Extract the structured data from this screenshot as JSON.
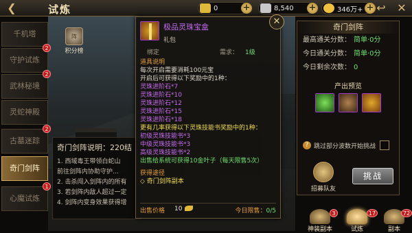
{
  "header": {
    "back_icon": "back-arrow-icon",
    "title": "试炼",
    "resources": [
      {
        "name": "gold-ingot",
        "value": "0",
        "color": "#e0b83a"
      },
      {
        "name": "currency",
        "value": "8,540",
        "color": "#c9c9c9"
      },
      {
        "name": "coin",
        "value": "346万+",
        "color": "#f0c040"
      }
    ]
  },
  "sidebar": {
    "items": [
      {
        "label": "千机塔",
        "badge": null
      },
      {
        "label": "守护试炼",
        "badge": "2"
      },
      {
        "label": "武林秘境",
        "badge": "2"
      },
      {
        "label": "灵蛇神殿",
        "badge": null
      },
      {
        "label": "古墓迷踪",
        "badge": "2"
      },
      {
        "label": "奇门剑阵",
        "badge": null,
        "active": true
      },
      {
        "label": "心魔试炼",
        "badge": "1"
      }
    ]
  },
  "rank": {
    "label": "积分榜",
    "emblem": "阵"
  },
  "description": {
    "title": "奇门剑阵说明：220结",
    "lines": [
      "1. 西域毒王带领白蛇山",
      "前往剑阵内协助守护...",
      "2. 击杀闯入剑阵内的所有",
      "3. 若剑阵内敌人超过一定",
      "4. 剑阵内变身效果获得增"
    ]
  },
  "tooltip": {
    "name": "极品灵珠宝盒",
    "type": "礼包",
    "bound": "绑定",
    "req_label": "需求：",
    "req_value": "1级",
    "lines": [
      {
        "text": "道具说明",
        "color": "orange"
      },
      {
        "text": "每次开启需要消耗100元宝",
        "color": "white"
      },
      {
        "text": "开启后可获得以下奖励中的1种：",
        "color": "white"
      },
      {
        "text": "灵珠进阶石*7",
        "color": "purple"
      },
      {
        "text": "灵珠进阶石*10",
        "color": "purple"
      },
      {
        "text": "灵珠进阶石*12",
        "color": "purple"
      },
      {
        "text": "灵珠进阶石*15",
        "color": "purple"
      },
      {
        "text": "灵珠进阶石*18",
        "color": "purple"
      },
      {
        "text": "更有几率获得以下灵珠技能书奖励中的1种：",
        "color": "yellow"
      },
      {
        "text": "初级灵珠技能书*3",
        "color": "purple"
      },
      {
        "text": "中级灵珠技能书*3",
        "color": "purple"
      },
      {
        "text": "高级灵珠技能书*2",
        "color": "purple"
      },
      {
        "text": "出售给系统可获得10金叶子（每天限售5次）",
        "color": "green"
      },
      {
        "text": "",
        "color": "white"
      },
      {
        "text": "获得途径",
        "color": "orange"
      },
      {
        "text": "◇ 奇门剑阵副本",
        "color": "yellow"
      }
    ],
    "price_label": "出售价格",
    "price_value": "10",
    "limit_label": "今日限售：",
    "limit_value": "0/5"
  },
  "right_panel": {
    "title": "奇门剑阵",
    "rows": [
      {
        "label": "最高通关分数：",
        "value": "简单·0分"
      },
      {
        "label": "今日通关分数：",
        "value": "简单·0分"
      },
      {
        "label": "今日剩余次数：",
        "value": "0"
      }
    ],
    "preview_title": "产出预览",
    "preview_items": [
      "green-gem-icon",
      "item-bag-icon",
      "gift-box-icon"
    ],
    "skip_label": "跳过部分波数开始挑战",
    "recruit_label": "招募队友",
    "fight_label": "挑战"
  },
  "bottom_nav": [
    {
      "label": "神装副本",
      "badge": "3"
    },
    {
      "label": "试炼",
      "badge": "17",
      "active": true
    },
    {
      "label": "副本",
      "badge": "72"
    }
  ]
}
